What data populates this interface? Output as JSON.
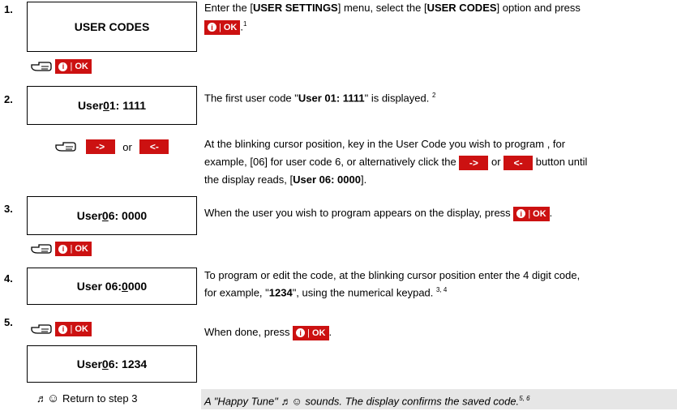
{
  "ok_label": "OK",
  "ok_info": "i",
  "arrow_right": "->",
  "arrow_left": "<-",
  "or_text": "or",
  "steps": {
    "s1": {
      "num": "1.",
      "lcd": "USER CODES",
      "desc_a": "Enter the [",
      "desc_b": "USER SETTINGS",
      "desc_c": "] menu, select the [",
      "desc_d": "USER CODES",
      "desc_e": "] option and press",
      "sup": "1"
    },
    "s2": {
      "num": "2.",
      "lcd_a": "User ",
      "lcd_u": "0",
      "lcd_b": "1: 1111",
      "desc_a": "The first user code \"",
      "desc_b": "User 01: 1111",
      "desc_c": "\" is displayed.",
      "sup": "2",
      "desc2_line1": "At the blinking cursor position, key in the User Code you wish to program , for",
      "desc2_line2a": "example, [06] for user code 6, or alternatively click the",
      "desc2_line2b": "button until",
      "desc2_line3a": "the display reads, [",
      "desc2_line3b": "User 06: 0000",
      "desc2_line3c": "]."
    },
    "s3": {
      "num": "3.",
      "lcd_a": "User ",
      "lcd_u": "0",
      "lcd_b": "6: 0000",
      "desc": "When the user you wish to program appears on the display, press"
    },
    "s4": {
      "num": "4.",
      "lcd_a": "User 06: ",
      "lcd_u": "0",
      "lcd_b": "000",
      "desc_line1": "To program or edit the code, at the blinking cursor position enter the 4 digit code,",
      "desc_line2a": "for example, \"",
      "desc_line2b": "1234",
      "desc_line2c": "\", using the numerical keypad.",
      "sup": "3, 4"
    },
    "s5": {
      "num": "5.",
      "desc": "When done, press",
      "lcd_a": "User ",
      "lcd_u": "0",
      "lcd_b": "6: 1234"
    },
    "final": {
      "return_text": "Return to step 3",
      "tune_text": "A \"Happy Tune\"",
      "tune_text2": "sounds. The display confirms the saved code.",
      "sup": "5, 6",
      "note_icon": "♬",
      "smile_icon": "☺"
    }
  }
}
